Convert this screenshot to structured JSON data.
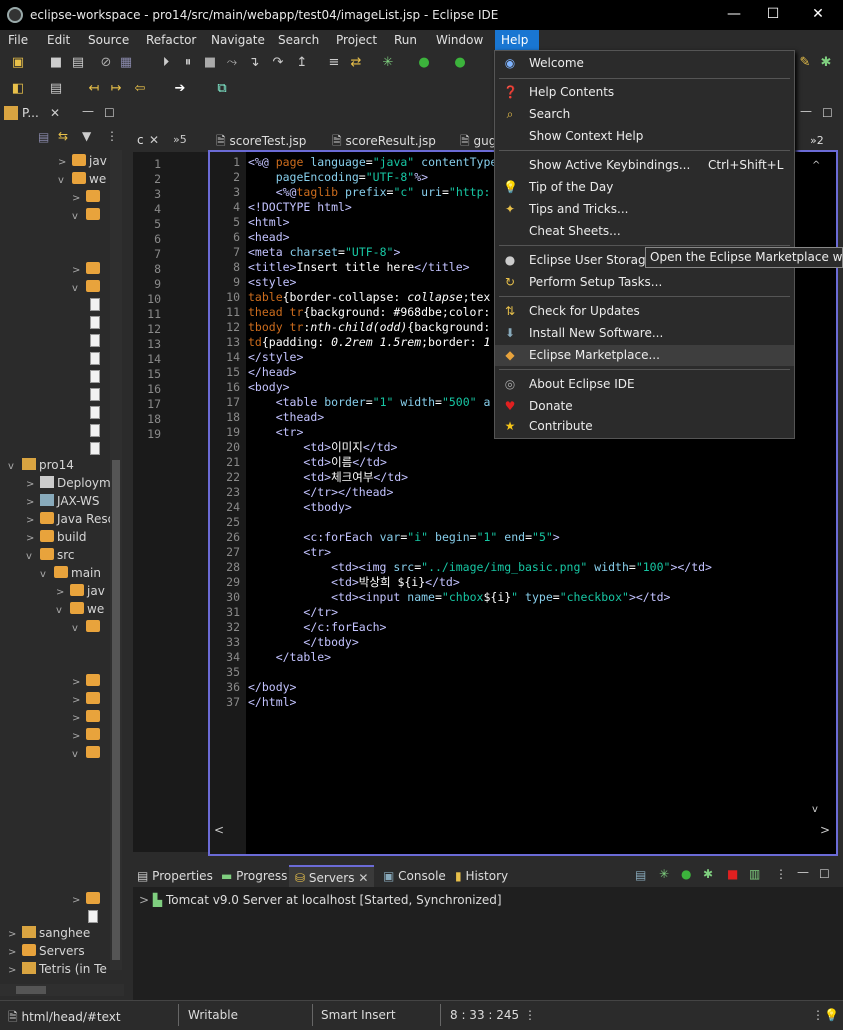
{
  "window": {
    "title": "eclipse-workspace - pro14/src/main/webapp/test04/imageList.jsp - Eclipse IDE",
    "minimize": "—",
    "maximize": "☐",
    "close": "✕"
  },
  "menubar": {
    "items": [
      "File",
      "Edit",
      "Source",
      "Refactor",
      "Navigate",
      "Search",
      "Project",
      "Run",
      "Window",
      "Help"
    ],
    "active": "Help"
  },
  "help_menu": {
    "items": [
      {
        "label": "Welcome",
        "icon": "globe-icon"
      },
      {
        "label": "Help Contents",
        "icon": "question-icon"
      },
      {
        "label": "Search",
        "icon": "search-help-icon"
      },
      {
        "label": "Show Context Help",
        "icon": ""
      },
      {
        "label": "Show Active Keybindings...",
        "shortcut": "Ctrl+Shift+L",
        "icon": ""
      },
      {
        "label": "Tip of the Day",
        "icon": "lightbulb-icon"
      },
      {
        "label": "Tips and Tricks...",
        "icon": "wand-icon"
      },
      {
        "label": "Cheat Sheets...",
        "icon": ""
      },
      {
        "label": "Eclipse User Storage",
        "icon": "user-storage-icon"
      },
      {
        "label": "Perform Setup Tasks...",
        "icon": "setup-icon"
      },
      {
        "label": "Check for Updates",
        "icon": "update-icon"
      },
      {
        "label": "Install New Software...",
        "icon": "install-icon"
      },
      {
        "label": "Eclipse Marketplace...",
        "icon": "marketplace-icon"
      },
      {
        "label": "About Eclipse IDE",
        "icon": "eclipse-icon"
      },
      {
        "label": "Donate",
        "icon": "heart-icon"
      },
      {
        "label": "Contribute",
        "icon": "star-icon"
      }
    ],
    "tooltip": "Open the Eclipse Marketplace wizard"
  },
  "left_panel": {
    "tab": "P...",
    "tree": [
      {
        "label": "jav",
        "kind": "folder"
      },
      {
        "label": "we",
        "kind": "folder"
      },
      {
        "label": "pro14",
        "kind": "project"
      },
      {
        "label": "Deploym",
        "kind": "node"
      },
      {
        "label": "JAX-WS",
        "kind": "node"
      },
      {
        "label": "Java Reso",
        "kind": "node"
      },
      {
        "label": "build",
        "kind": "folder"
      },
      {
        "label": "src",
        "kind": "folder"
      },
      {
        "label": "main",
        "kind": "folder"
      },
      {
        "label": "jav",
        "kind": "folder"
      },
      {
        "label": "we",
        "kind": "folder"
      },
      {
        "label": "sanghee",
        "kind": "project"
      },
      {
        "label": "Servers",
        "kind": "folder"
      },
      {
        "label": "Tetris (in Te",
        "kind": "project"
      }
    ]
  },
  "small_editor": {
    "tab": "c",
    "more": "»5",
    "lines": [
      "1",
      "2",
      "3",
      "4",
      "5",
      "6",
      "7",
      "8",
      "9",
      "10",
      "11",
      "12",
      "13",
      "14",
      "15",
      "16",
      "17",
      "18",
      "19"
    ]
  },
  "editor_tabs": {
    "tabs": [
      "scoreTest.jsp",
      "scoreResult.jsp",
      "gug"
    ],
    "more": "»2"
  },
  "editor": {
    "lines": [
      {
        "n": "1",
        "html": "<span class='tag'>&lt;%@</span> <span class='kw'>page</span> <span class='attr'>language</span>=<span class='str'>\"java\"</span> <span class='attr'>contentType</span>"
      },
      {
        "n": "2",
        "html": "    <span class='attr'>pageEncoding</span>=<span class='str'>\"UTF-8\"</span><span class='tag'>%&gt;</span>"
      },
      {
        "n": "3",
        "html": "    <span class='tag'>&lt;%@</span><span class='kw'>taglib</span> <span class='attr'>prefix</span>=<span class='str'>\"c\"</span> <span class='attr'>uri</span>=<span class='str'>\"http:</span>"
      },
      {
        "n": "4",
        "html": "<span class='tag'>&lt;!DOCTYPE html&gt;</span>"
      },
      {
        "n": "5",
        "html": "<span class='tag'>&lt;html&gt;</span>"
      },
      {
        "n": "6",
        "html": "<span class='tag'>&lt;head&gt;</span>"
      },
      {
        "n": "7",
        "html": "<span class='tag'>&lt;meta</span> <span class='attr'>charset</span>=<span class='str'>\"UTF-8\"</span><span class='tag'>&gt;</span>"
      },
      {
        "n": "8",
        "html": "<span class='tag'>&lt;title&gt;</span>Insert title here<span class='tag'>&lt;/title&gt;</span>"
      },
      {
        "n": "9",
        "html": "<span class='tag'>&lt;style&gt;</span>"
      },
      {
        "n": "10",
        "html": "<span class='kw'>table</span>{border-collapse: <i>collapse</i>;tex"
      },
      {
        "n": "11",
        "html": "<span class='kw'>thead tr</span>{background: #968dbe;color:"
      },
      {
        "n": "12",
        "html": "<span class='kw'>tbody tr</span>:<i>nth-child(odd)</i>{background:"
      },
      {
        "n": "13",
        "html": "<span class='kw'>td</span>{padding: <i>0.2rem 1.5rem</i>;border: <i>1</i>"
      },
      {
        "n": "14",
        "html": "<span class='tag'>&lt;/style&gt;</span>"
      },
      {
        "n": "15",
        "html": "<span class='tag'>&lt;/head&gt;</span>"
      },
      {
        "n": "16",
        "html": "<span class='tag'>&lt;body&gt;</span>"
      },
      {
        "n": "17",
        "html": "    <span class='tag'>&lt;table</span> <span class='attr'>border</span>=<span class='str'>\"1\"</span> <span class='attr'>width</span>=<span class='str'>\"500\"</span> <span class='attr'>a</span>"
      },
      {
        "n": "18",
        "html": "    <span class='tag'>&lt;thead&gt;</span>"
      },
      {
        "n": "19",
        "html": "    <span class='tag'>&lt;tr&gt;</span>"
      },
      {
        "n": "20",
        "html": "        <span class='tag'>&lt;td&gt;</span>이미지<span class='tag'>&lt;/td&gt;</span>"
      },
      {
        "n": "21",
        "html": "        <span class='tag'>&lt;td&gt;</span>이름<span class='tag'>&lt;/td&gt;</span>"
      },
      {
        "n": "22",
        "html": "        <span class='tag'>&lt;td&gt;</span>체크여부<span class='tag'>&lt;/td&gt;</span>"
      },
      {
        "n": "23",
        "html": "        <span class='tag'>&lt;/tr&gt;&lt;/thead&gt;</span>"
      },
      {
        "n": "24",
        "html": "        <span class='tag'>&lt;tbody&gt;</span>"
      },
      {
        "n": "25",
        "html": ""
      },
      {
        "n": "26",
        "html": "        <span class='tag'>&lt;c:forEach</span> <span class='attr'>var</span>=<span class='str'>\"i\"</span> <span class='attr'>begin</span>=<span class='str'>\"1\"</span> <span class='attr'>end</span>=<span class='str'>\"5\"</span><span class='tag'>&gt;</span>"
      },
      {
        "n": "27",
        "html": "        <span class='tag'>&lt;tr&gt;</span>"
      },
      {
        "n": "28",
        "html": "            <span class='tag'>&lt;td&gt;&lt;img</span> <span class='attr'>src</span>=<span class='str'>\"../image/img_basic.png\"</span> <span class='attr'>width</span>=<span class='str'>\"100\"</span><span class='tag'>&gt;&lt;/td&gt;</span>"
      },
      {
        "n": "29",
        "html": "            <span class='tag'>&lt;td&gt;</span>박상희 ${i}<span class='tag'>&lt;/td&gt;</span>"
      },
      {
        "n": "30",
        "html": "            <span class='tag'>&lt;td&gt;&lt;input</span> <span class='attr'>name</span>=<span class='str'>\"chbox</span>${i}<span class='str'>\"</span> <span class='attr'>type</span>=<span class='str'>\"checkbox\"</span><span class='tag'>&gt;&lt;/td&gt;</span>"
      },
      {
        "n": "31",
        "html": "        <span class='tag'>&lt;/tr&gt;</span>"
      },
      {
        "n": "32",
        "html": "        <span class='tag'>&lt;/c:forEach&gt;</span>"
      },
      {
        "n": "33",
        "html": "        <span class='tag'>&lt;/tbody&gt;</span>"
      },
      {
        "n": "34",
        "html": "    <span class='tag'>&lt;/table&gt;</span>"
      },
      {
        "n": "35",
        "html": ""
      },
      {
        "n": "36",
        "html": "<span class='tag'>&lt;/body&gt;</span>"
      },
      {
        "n": "37",
        "html": "<span class='tag'>&lt;/html&gt;</span>"
      }
    ]
  },
  "bottom_panel": {
    "tabs": [
      "Properties",
      "Progress",
      "Servers",
      "Console",
      "History"
    ],
    "active": "Servers",
    "server_entry": "Tomcat v9.0 Server at localhost  [Started, Synchronized]"
  },
  "statusbar": {
    "path": "html/head/#text",
    "writable": "Writable",
    "insert_mode": "Smart Insert",
    "position": "8 : 33 : 245"
  }
}
